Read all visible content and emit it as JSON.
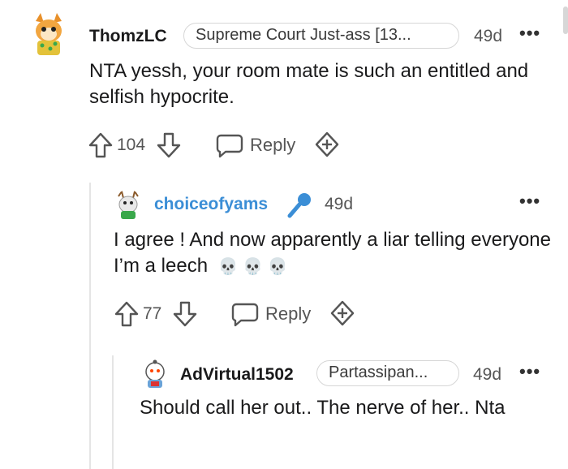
{
  "comments": [
    {
      "username": "ThomzLC",
      "flair": "Supreme Court Just-ass [13...",
      "age": "49d",
      "text": "NTA yessh, your room mate is such an entitled and selfish hypocrite.",
      "votes": "104",
      "reply_label": "Reply"
    },
    {
      "username": "choiceofyams",
      "age": "49d",
      "text": "I agree ! And now apparently a liar telling everyone I’m a leech",
      "emoji": "💀 💀 💀",
      "votes": "77",
      "reply_label": "Reply"
    },
    {
      "username": "AdVirtual1502",
      "flair": "Partassipan...",
      "age": "49d",
      "text": "Should call her out.. The nerve of her.. Nta"
    }
  ],
  "colors": {
    "accent_blue": "#3b8ed6",
    "muted": "#555555",
    "border": "#d6d6d6"
  },
  "icons": [
    "upvote-icon",
    "downvote-icon",
    "comment-bubble-icon",
    "award-icon",
    "more-dots-icon",
    "microphone-icon"
  ]
}
